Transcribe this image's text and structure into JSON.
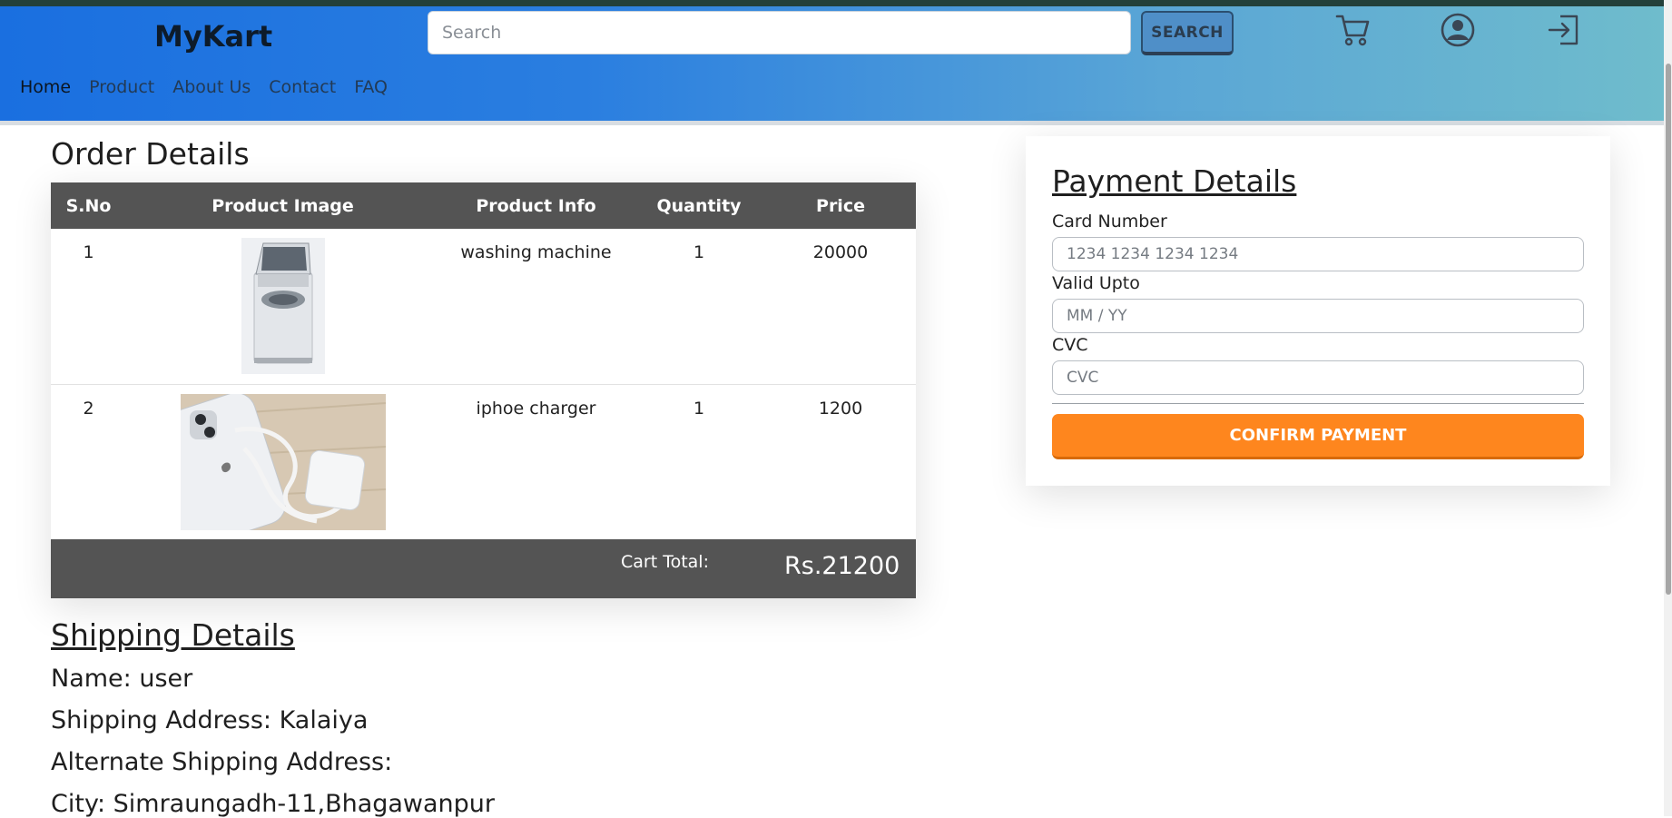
{
  "header": {
    "brand": "MyKart",
    "search_placeholder": "Search",
    "search_button": "SEARCH",
    "icons": [
      "cart-icon",
      "user-icon",
      "logout-icon"
    ]
  },
  "nav": [
    {
      "label": "Home",
      "active": true
    },
    {
      "label": "Product"
    },
    {
      "label": "About Us"
    },
    {
      "label": "Contact"
    },
    {
      "label": "FAQ"
    }
  ],
  "order": {
    "title": "Order Details",
    "columns": [
      "S.No",
      "Product Image",
      "Product Info",
      "Quantity",
      "Price"
    ],
    "rows": [
      {
        "sno": "1",
        "image": "washing-machine-image",
        "info": "washing machine",
        "quantity": "1",
        "price": "20000"
      },
      {
        "sno": "2",
        "image": "iphone-charger-image",
        "info": "iphoe charger",
        "quantity": "1",
        "price": "1200"
      }
    ],
    "cart_total_label": "Cart Total:",
    "cart_total_value": "Rs.21200"
  },
  "shipping": {
    "title": "Shipping Details",
    "name": "Name: user",
    "address": "Shipping Address: Kalaiya",
    "alternate": "Alternate Shipping Address:",
    "city": "City: Simraungadh-11,Bhagawanpur"
  },
  "payment": {
    "title": "Payment Details",
    "card_label": "Card Number",
    "card_placeholder": "1234 1234 1234 1234",
    "valid_label": "Valid Upto",
    "valid_placeholder": "MM / YY",
    "cvc_label": "CVC",
    "cvc_placeholder": "CVC",
    "confirm_button": "CONFIRM PAYMENT"
  },
  "colors": {
    "header_start": "#1a6fe0",
    "header_end": "#6fbccc",
    "table_header": "#545454",
    "confirm": "#fe861e"
  }
}
